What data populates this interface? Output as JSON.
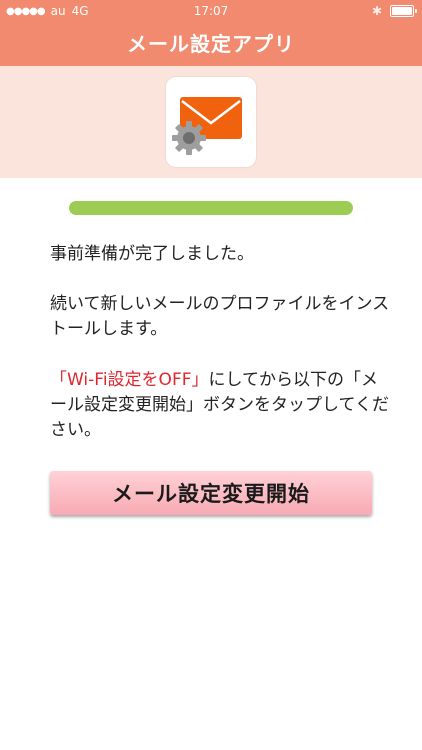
{
  "status_bar": {
    "signal_dots": "●●●●●",
    "carrier": "au",
    "network": "4G",
    "time": "17:07",
    "bluetooth_icon": "bluetooth-icon",
    "battery_icon": "battery-icon"
  },
  "nav": {
    "title": "メール設定アプリ"
  },
  "hero": {
    "app_icon": "mail-settings-icon"
  },
  "progress": {
    "value_percent": 100
  },
  "message": {
    "line1": "事前準備が完了しました。",
    "line2": "続いて新しいメールのプロファイルをインストールします。",
    "line3_red": "「Wi-Fi設定をOFF」",
    "line3_rest": "にしてから以下の「メール設定変更開始」ボタンをタップしてください。"
  },
  "button": {
    "label": "メール設定変更開始"
  },
  "colors": {
    "header": "#f18a6e",
    "hero_bg": "#fbe4dc",
    "envelope": "#f0620e",
    "progress": "#9ccc54",
    "warning_text": "#e0262e",
    "button": "#f8aab3"
  }
}
